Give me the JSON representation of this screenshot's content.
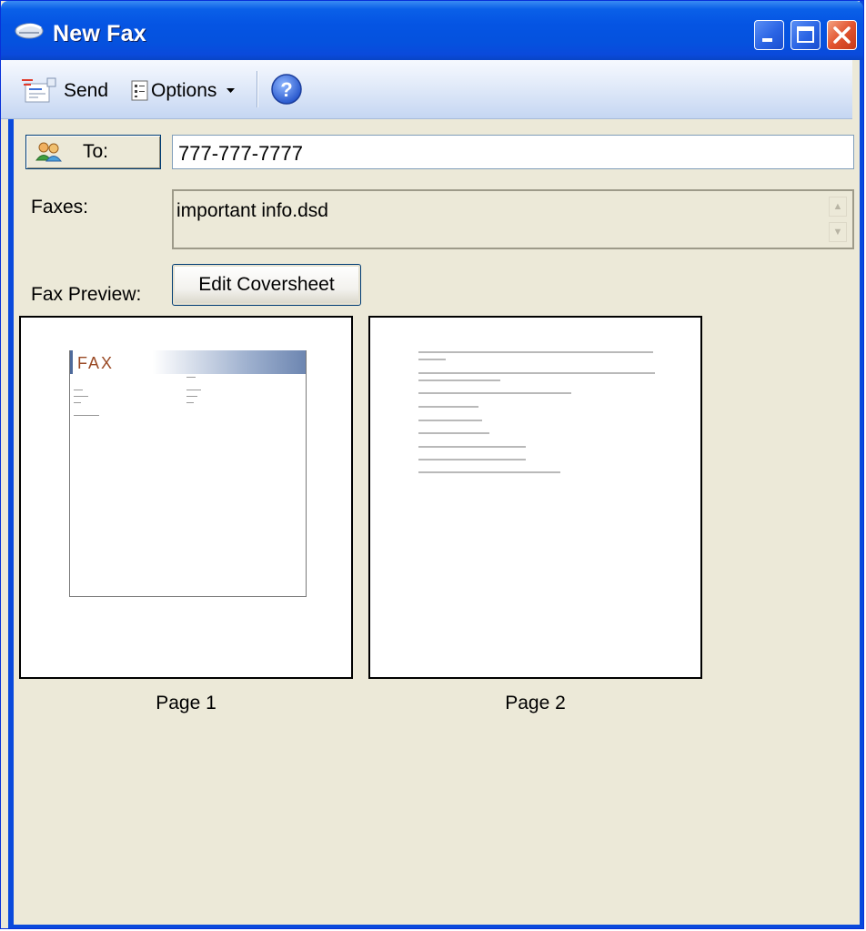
{
  "window": {
    "title": "New Fax"
  },
  "toolbar": {
    "send_label": "Send",
    "options_label": "Options"
  },
  "to": {
    "button_label": "To:",
    "value": "777-777-7777"
  },
  "faxes": {
    "label": "Faxes:",
    "file": "important info.dsd"
  },
  "preview": {
    "label": "Fax Preview:",
    "edit_coversheet_label": "Edit Coversheet",
    "pages": [
      {
        "caption": "Page 1",
        "cover_title": "FAX"
      },
      {
        "caption": "Page 2"
      }
    ]
  }
}
